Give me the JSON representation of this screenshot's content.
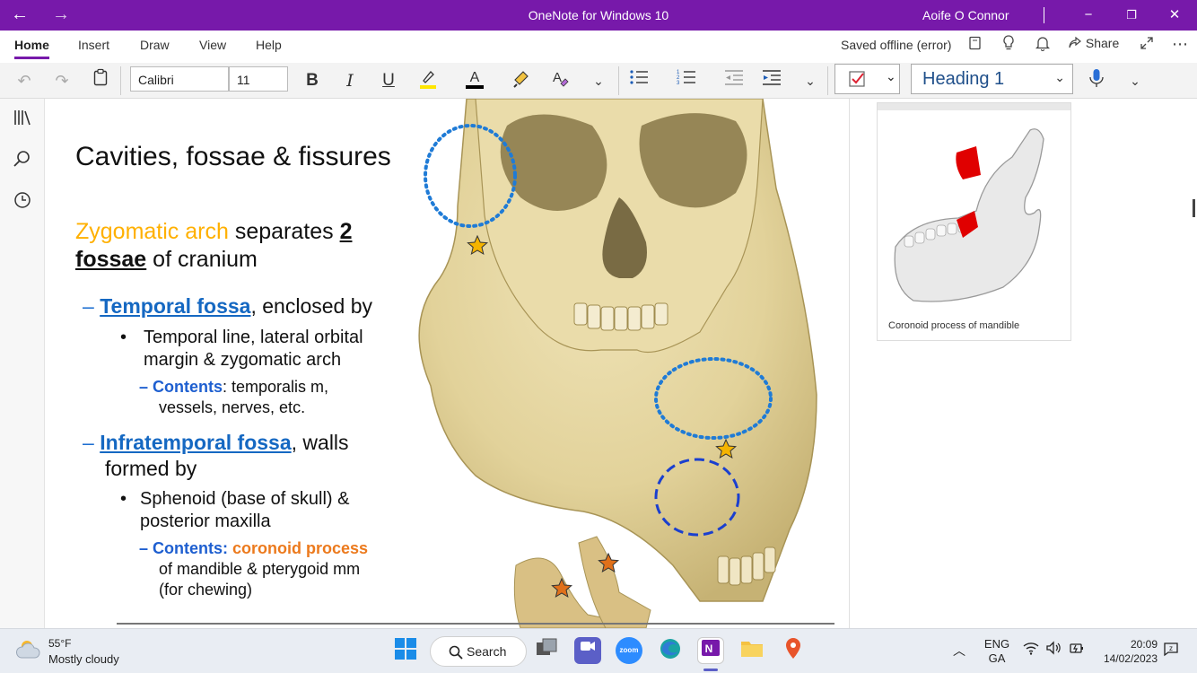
{
  "window": {
    "title": "OneNote for Windows 10",
    "user": "Aoife O Connor",
    "back_glyph": "←",
    "forward_glyph": "→",
    "minimize_glyph": "−",
    "restore_glyph": "❐",
    "close_glyph": "✕"
  },
  "menu": {
    "tabs": [
      "Home",
      "Insert",
      "Draw",
      "View",
      "Help"
    ],
    "active_tab": "Home",
    "status": "Saved offline (error)",
    "share_label": "Share"
  },
  "toolbar": {
    "font_name": "Calibri",
    "font_size": "11",
    "bold": "B",
    "italic": "I",
    "underline": "U",
    "style": "Heading 1",
    "colors": {
      "highlight": "#ffe600",
      "font_color": "#000000",
      "accent": "#7719aa"
    }
  },
  "slide": {
    "title": "Cavities, fossae & fissures",
    "intro": {
      "part1": "Zygomatic arch",
      "part2": " separates ",
      "part3": "2",
      "part4": "fossae",
      "part5": " of cranium"
    },
    "temporal": {
      "dash": "–",
      "name": "Temporal fossa",
      "rest": ", enclosed by",
      "bullet": "•",
      "line1": "Temporal line, lateral orbital",
      "line2": "margin & zygomatic arch",
      "contents_label": "Contents",
      "contents_rest": ": temporalis m,",
      "contents_line2": "vessels, nerves, etc."
    },
    "infratemporal": {
      "dash": "–",
      "name": "Infratemporal fossa",
      "rest": ", walls",
      "rest2": "formed by",
      "bullet": "•",
      "line1": "Sphenoid (base of skull) &",
      "line2": "posterior maxilla",
      "contents_label": "Contents",
      "contents_colon": ": ",
      "coronoid": "coronoid process",
      "contents_line2": "of mandible & pterygoid mm",
      "contents_line3": "(for chewing)"
    }
  },
  "side_image": {
    "caption": "Coronoid process of mandible"
  },
  "taskbar": {
    "temperature": "55°F",
    "weather": "Mostly cloudy",
    "search_label": "Search",
    "zoom_label": "zoom",
    "lang1": "ENG",
    "lang2": "GA",
    "time": "20:09",
    "date": "14/02/2023"
  }
}
